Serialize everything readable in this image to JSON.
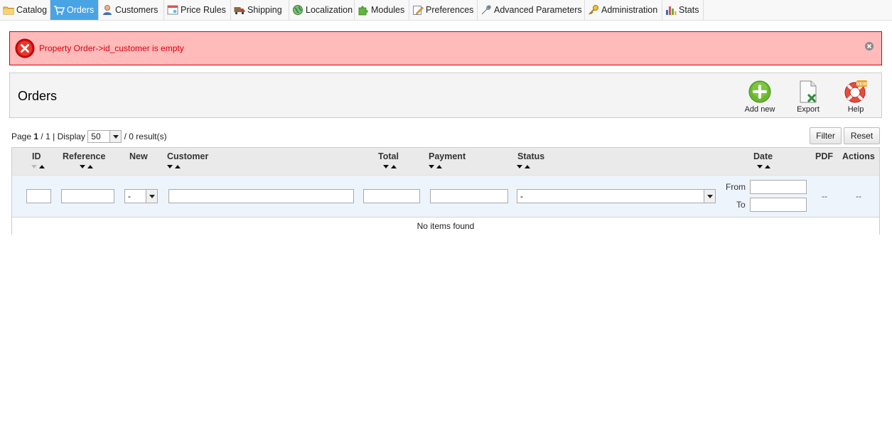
{
  "nav": {
    "items": [
      {
        "label": "Catalog",
        "icon": "folder-icon"
      },
      {
        "label": "Orders",
        "icon": "cart-icon",
        "active": true
      },
      {
        "label": "Customers",
        "icon": "user-icon"
      },
      {
        "label": "Price Rules",
        "icon": "price-tag-icon"
      },
      {
        "label": "Shipping",
        "icon": "truck-icon"
      },
      {
        "label": "Localization",
        "icon": "globe-icon"
      },
      {
        "label": "Modules",
        "icon": "puzzle-icon"
      },
      {
        "label": "Preferences",
        "icon": "edit-icon"
      },
      {
        "label": "Advanced Parameters",
        "icon": "wrench-icon"
      },
      {
        "label": "Administration",
        "icon": "key-icon"
      },
      {
        "label": "Stats",
        "icon": "bar-chart-icon"
      }
    ]
  },
  "error": {
    "message": "Property Order->id_customer is empty"
  },
  "toolbar": {
    "title": "Orders",
    "add_new_label": "Add new",
    "export_label": "Export",
    "help_label": "Help",
    "help_badge": "NEW"
  },
  "pager": {
    "page_word": "Page",
    "current_page": "1",
    "separator": "/",
    "total_pages": "1",
    "display_label": "| Display",
    "per_page": "50",
    "results": "/ 0 result(s)"
  },
  "actions": {
    "filter_label": "Filter",
    "reset_label": "Reset"
  },
  "table": {
    "columns": {
      "id": "ID",
      "reference": "Reference",
      "new": "New",
      "customer": "Customer",
      "total": "Total",
      "payment": "Payment",
      "status": "Status",
      "date": "Date",
      "pdf": "PDF",
      "actions": "Actions"
    },
    "filters": {
      "new_value": "-",
      "status_value": "-",
      "date_from_label": "From",
      "date_to_label": "To",
      "pdf_placeholder": "--",
      "actions_placeholder": "--"
    },
    "empty_message": "No items found"
  },
  "colors": {
    "nav_active_bg": "#49a4e6",
    "error_bg": "#ffbaba",
    "error_text": "#d8000c",
    "filter_row_bg": "#eef4fc",
    "add_button": "#6ab82e"
  }
}
